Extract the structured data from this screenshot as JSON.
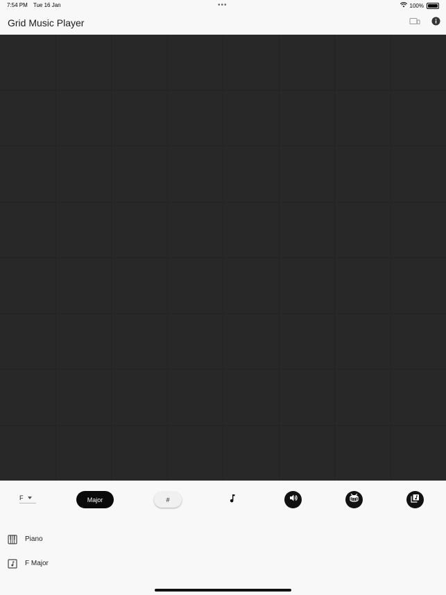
{
  "status_bar": {
    "time": "7:54 PM",
    "date": "Tue 16 Jan",
    "dots": "•••",
    "battery": "100%",
    "icons": [
      "wifi-icon",
      "battery-icon"
    ]
  },
  "header": {
    "title": "Grid Music Player",
    "icons": [
      "device-icon",
      "info-icon"
    ]
  },
  "grid": {
    "rows": 8,
    "columns": 8
  },
  "controls": {
    "key": "F",
    "scale_label": "Major",
    "accidental_label": "#",
    "icons": [
      "music-note-icon",
      "volume-icon",
      "drum-icon",
      "library-music-icon"
    ]
  },
  "info": {
    "instrument": "Piano",
    "scale": "F Major",
    "icons": [
      "piano-icon",
      "music-box-icon"
    ]
  },
  "colors": {
    "grid_background": "#232323",
    "grid_cell": "#282828",
    "page_background": "#f8f8f8",
    "accent_dark": "#111111"
  }
}
